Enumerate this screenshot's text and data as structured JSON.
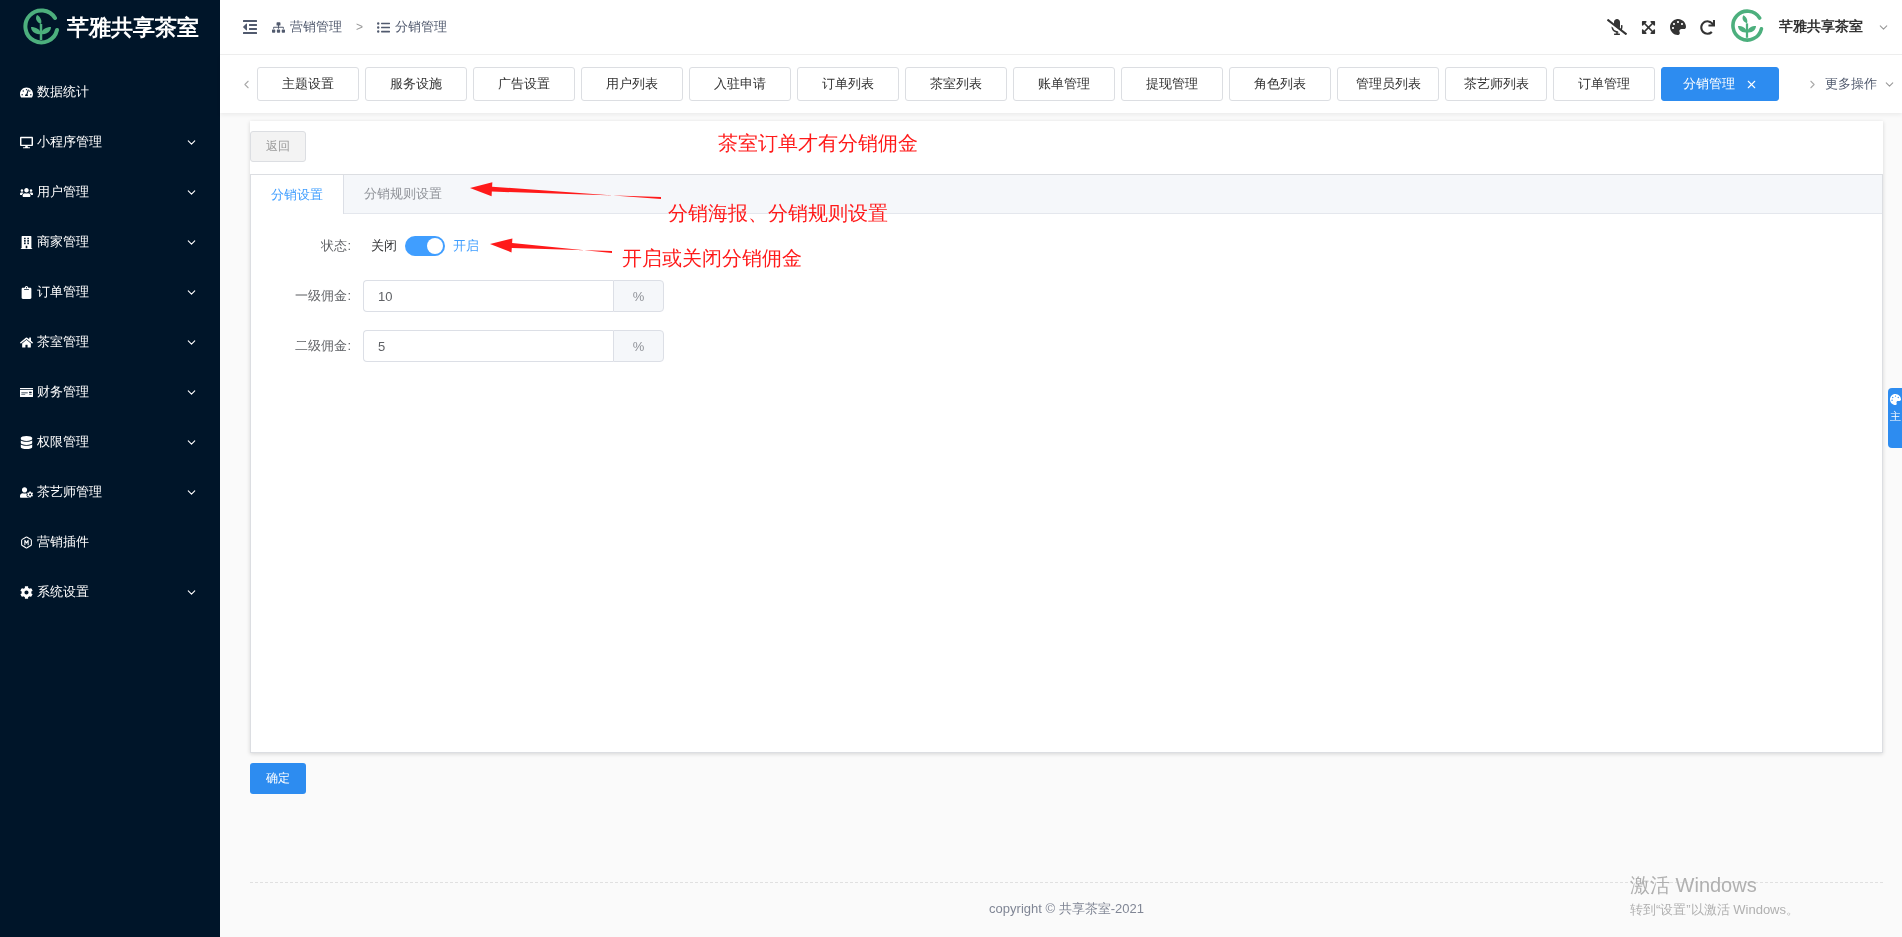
{
  "brand": {
    "name": "芊雅共享茶室"
  },
  "sidebar": {
    "items": [
      {
        "label": "数据统计",
        "expandable": false
      },
      {
        "label": "小程序管理",
        "expandable": true
      },
      {
        "label": "用户管理",
        "expandable": true
      },
      {
        "label": "商家管理",
        "expandable": true
      },
      {
        "label": "订单管理",
        "expandable": true
      },
      {
        "label": "茶室管理",
        "expandable": true
      },
      {
        "label": "财务管理",
        "expandable": true
      },
      {
        "label": "权限管理",
        "expandable": true
      },
      {
        "label": "茶艺师管理",
        "expandable": true
      },
      {
        "label": "营销插件",
        "expandable": false
      },
      {
        "label": "系统设置",
        "expandable": true
      }
    ]
  },
  "breadcrumb": [
    "营销管理",
    "分销管理"
  ],
  "breadcrumb_separator": ">",
  "user": {
    "name": "芊雅共享茶室"
  },
  "tabs": [
    {
      "label": "主题设置",
      "selected": false
    },
    {
      "label": "服务设施",
      "selected": false
    },
    {
      "label": "广告设置",
      "selected": false
    },
    {
      "label": "用户列表",
      "selected": false
    },
    {
      "label": "入驻申请",
      "selected": false
    },
    {
      "label": "订单列表",
      "selected": false
    },
    {
      "label": "茶室列表",
      "selected": false
    },
    {
      "label": "账单管理",
      "selected": false
    },
    {
      "label": "提现管理",
      "selected": false
    },
    {
      "label": "角色列表",
      "selected": false
    },
    {
      "label": "管理员列表",
      "selected": false
    },
    {
      "label": "茶艺师列表",
      "selected": false
    },
    {
      "label": "订单管理",
      "selected": false
    },
    {
      "label": "分销管理",
      "selected": true
    }
  ],
  "more_menu": "更多操作",
  "back_button": "返回",
  "form_tabs": [
    {
      "label": "分销设置",
      "selected": true
    },
    {
      "label": "分销规则设置",
      "selected": false
    }
  ],
  "status": {
    "label": "状态:",
    "off_text": "关闭",
    "on_text": "开启",
    "on": true
  },
  "fields": [
    {
      "label": "一级佣金:",
      "value": "10",
      "suffix": "%"
    },
    {
      "label": "二级佣金:",
      "value": "5",
      "suffix": "%"
    }
  ],
  "confirm_button": "确定",
  "side_tab": "主",
  "footer": "copyright © 共享茶室-2021",
  "annotations": [
    {
      "text": "茶室订单才有分销佣金",
      "arrow": false
    },
    {
      "text": "分销海报、分销规则设置",
      "arrow": true
    },
    {
      "text": "开启或关闭分销佣金",
      "arrow": true
    }
  ],
  "os_notice": {
    "title": "激活 Windows",
    "subtitle": "转到“设置”以激活 Windows。"
  }
}
